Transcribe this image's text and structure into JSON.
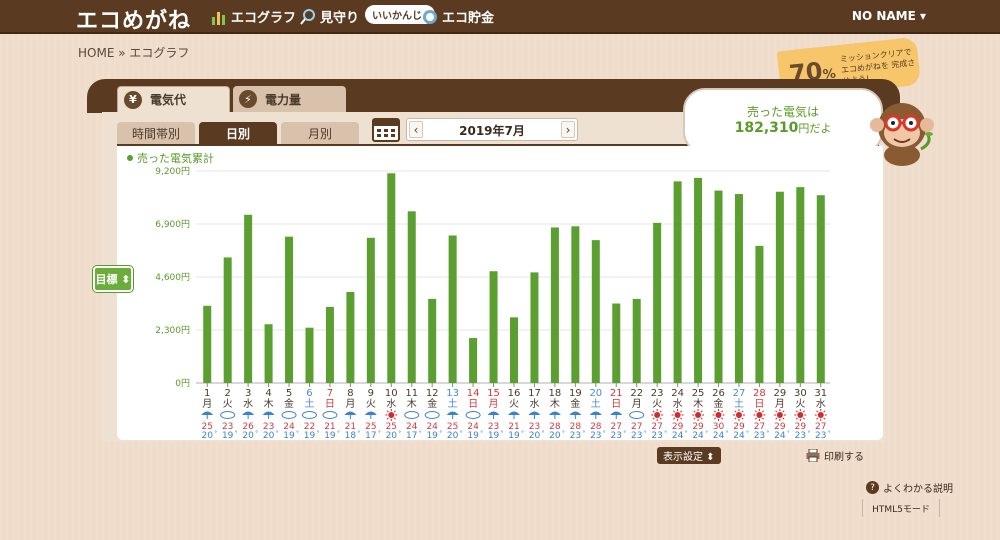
{
  "header": {
    "logo": "エコめがね",
    "nav": [
      {
        "label": "エコグラフ",
        "icon": "bar-chart-icon"
      },
      {
        "label": "見守り",
        "icon": "magnifier-icon"
      },
      {
        "label": "エコ貯金",
        "icon": "piggy-icon"
      }
    ],
    "bubble": "いいかんじ♪",
    "user": "NO NAME ▾"
  },
  "breadcrumb": "HOME » エコグラフ",
  "tabs": {
    "main": [
      {
        "label": "電気代",
        "icon_glyph": "¥",
        "icon": "yen-icon"
      },
      {
        "label": "電力量",
        "icon_glyph": "⚡",
        "icon": "bolt-icon"
      }
    ],
    "sub": [
      "時間帯別",
      "日別",
      "月別"
    ]
  },
  "month": {
    "label": "2019年7月",
    "prev": "‹",
    "next": "›"
  },
  "goal_button": "目標 ⬍",
  "sold": {
    "label": "売った電気は",
    "value": "182,310",
    "unit": "円だよ"
  },
  "mission": {
    "percent": "70",
    "percent_unit": "%",
    "text": "ミッションクリアで エコめがねを 完成させよう!"
  },
  "controls": {
    "display": "表示設定 ⬍",
    "print": "印刷する"
  },
  "footer": {
    "help": "よくわかる説明",
    "help_icon_glyph": "?",
    "html5": "HTML5モード"
  },
  "colors": {
    "bar": "#5a9f2f",
    "weekday": "#4a3a2c",
    "saturday": "#4a8ad6",
    "sunday": "#d23a3a",
    "sun": "#d32b2b",
    "rain": "#3a82d0",
    "hi": "#d23a3a",
    "lo": "#3a82d0"
  },
  "chart_data": {
    "type": "bar",
    "legend": "売った電気累計",
    "ylim": [
      0,
      9200
    ],
    "yticks": [
      "9,200円",
      "6,900円",
      "4,600円",
      "2,300円",
      "0円"
    ],
    "ytick_values": [
      9200,
      6900,
      4600,
      2300,
      0
    ],
    "days": [
      "1",
      "2",
      "3",
      "4",
      "5",
      "6",
      "7",
      "8",
      "9",
      "10",
      "11",
      "12",
      "13",
      "14",
      "15",
      "16",
      "17",
      "18",
      "19",
      "20",
      "21",
      "22",
      "23",
      "24",
      "25",
      "26",
      "27",
      "28",
      "29",
      "30",
      "31"
    ],
    "weekdays": [
      "月",
      "火",
      "水",
      "木",
      "金",
      "土",
      "日",
      "月",
      "火",
      "水",
      "木",
      "金",
      "土",
      "日",
      "月",
      "火",
      "水",
      "木",
      "金",
      "土",
      "日",
      "月",
      "火",
      "水",
      "木",
      "金",
      "土",
      "日",
      "月",
      "火",
      "水"
    ],
    "day_types": [
      "w",
      "w",
      "w",
      "w",
      "w",
      "sat",
      "sun",
      "w",
      "w",
      "w",
      "w",
      "w",
      "sat",
      "sun",
      "sun",
      "w",
      "w",
      "w",
      "w",
      "sat",
      "sun",
      "w",
      "w",
      "w",
      "w",
      "w",
      "sat",
      "sun",
      "w",
      "w",
      "w"
    ],
    "values": [
      3350,
      5450,
      7300,
      2550,
      6350,
      2400,
      3300,
      3950,
      6300,
      9100,
      7450,
      3650,
      6400,
      1950,
      4850,
      2850,
      4800,
      6750,
      6800,
      6200,
      3450,
      3650,
      6950,
      8750,
      8900,
      8350,
      8200,
      5950,
      8300,
      8500,
      8150
    ],
    "weather": [
      "rain",
      "cloud",
      "rain",
      "rain",
      "cloud",
      "cloud",
      "cloud",
      "rain",
      "rain",
      "sun",
      "cloud",
      "cloud",
      "rain",
      "cloud",
      "rain",
      "rain",
      "rain",
      "rain",
      "rain",
      "rain",
      "rain",
      "cloud",
      "sun",
      "sun",
      "sun",
      "sun",
      "sun",
      "sun",
      "sun",
      "sun",
      "sun"
    ],
    "temp_high": [
      "25",
      "23",
      "26",
      "23",
      "24",
      "22",
      "21",
      "21",
      "25",
      "25",
      "24",
      "24",
      "25",
      "24",
      "23",
      "21",
      "23",
      "28",
      "28",
      "28",
      "27",
      "27",
      "27",
      "29",
      "29",
      "30",
      "29",
      "27",
      "29",
      "29",
      "27"
    ],
    "temp_low": [
      "20",
      "19",
      "20",
      "20",
      "19",
      "19",
      "19",
      "18",
      "17",
      "20",
      "17",
      "19",
      "20",
      "19",
      "19",
      "19",
      "20",
      "20",
      "23",
      "23",
      "23",
      "23",
      "23",
      "24",
      "24",
      "24",
      "24",
      "23",
      "24",
      "23",
      "23"
    ],
    "degree_unit": "°"
  }
}
